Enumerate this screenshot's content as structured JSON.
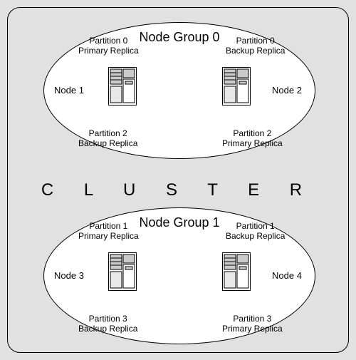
{
  "cluster_label": "C L U S T E R",
  "groups": [
    {
      "title": "Node Group 0",
      "left_node": "Node 1",
      "right_node": "Node 2",
      "top_left": {
        "partition": "Partition 0",
        "role": "Primary Replica"
      },
      "top_right": {
        "partition": "Partition 0",
        "role": "Backup Replica"
      },
      "bot_left": {
        "partition": "Partition 2",
        "role": "Backup Replica"
      },
      "bot_right": {
        "partition": "Partition 2",
        "role": "Primary Replica"
      }
    },
    {
      "title": "Node Group 1",
      "left_node": "Node 3",
      "right_node": "Node 4",
      "top_left": {
        "partition": "Partition 1",
        "role": "Primary Replica"
      },
      "top_right": {
        "partition": "Partition 1",
        "role": "Backup Replica"
      },
      "bot_left": {
        "partition": "Partition 3",
        "role": "Backup Replica"
      },
      "bot_right": {
        "partition": "Partition 3",
        "role": "Primary Replica"
      }
    }
  ]
}
